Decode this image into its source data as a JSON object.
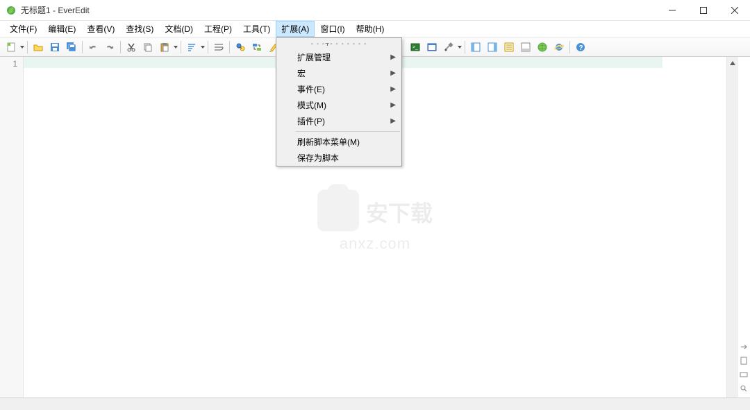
{
  "window": {
    "title": "无标题1 - EverEdit"
  },
  "menubar": {
    "items": [
      {
        "label": "文件(F)"
      },
      {
        "label": "编辑(E)"
      },
      {
        "label": "查看(V)"
      },
      {
        "label": "查找(S)"
      },
      {
        "label": "文档(D)"
      },
      {
        "label": "工程(P)"
      },
      {
        "label": "工具(T)"
      },
      {
        "label": "扩展(A)",
        "active": true
      },
      {
        "label": "窗口(I)"
      },
      {
        "label": "帮助(H)"
      }
    ]
  },
  "dropdown": {
    "tearoff": "- - -⫟- - - - - - -",
    "items": [
      {
        "label": "扩展管理",
        "submenu": true
      },
      {
        "label": "宏",
        "submenu": true
      },
      {
        "label": "事件(E)",
        "submenu": true
      },
      {
        "label": "模式(M)",
        "submenu": true
      },
      {
        "label": "插件(P)",
        "submenu": true
      }
    ],
    "items2": [
      {
        "label": "刷新脚本菜单(M)"
      },
      {
        "label": "保存为脚本"
      }
    ]
  },
  "gutter": {
    "line1": "1"
  },
  "watermark": {
    "text1": "安下载",
    "text2": "anxz.com"
  }
}
